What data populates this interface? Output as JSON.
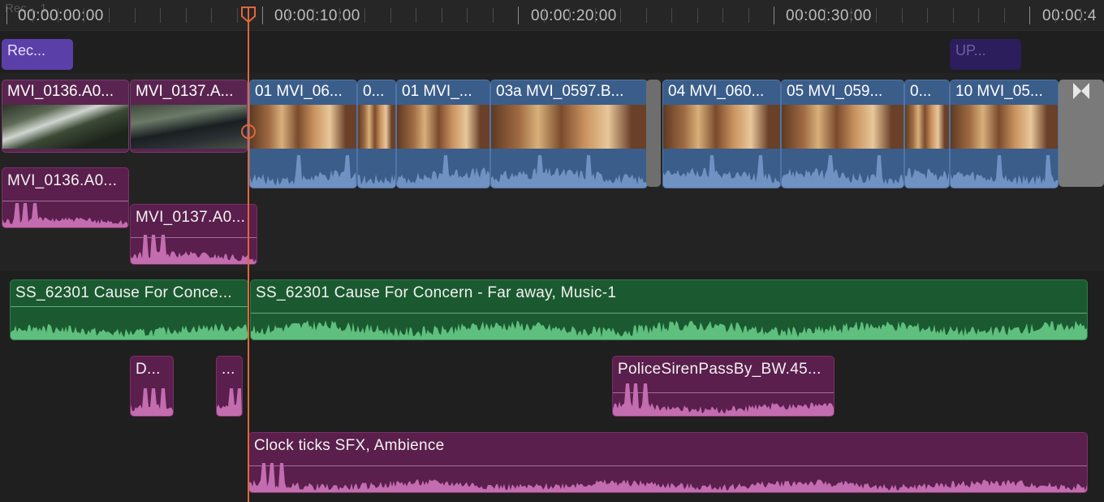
{
  "ruler": {
    "timecodes": [
      "00:00:00:00",
      "00:00:10:00",
      "00:00:20:00",
      "00:00:30:00",
      "00:00:4"
    ],
    "faint_label": "Rec... 1"
  },
  "markers": {
    "rec_label": "Rec...",
    "up_label": "UP..."
  },
  "video_clips": [
    "MVI_0136.A0...",
    "MVI_0137.A...",
    "01 MVI_06...",
    "0...",
    "01 MVI_...",
    "03a MVI_0597.B...",
    "04 MVI_060...",
    "05 MVI_059...",
    "0...",
    "10 MVI_05..."
  ],
  "connected_audio": {
    "clip_0136": "MVI_0136.A0...",
    "clip_0137": "MVI_0137.A0..."
  },
  "music": {
    "clip_a": "SS_62301 Cause For Conce...",
    "clip_b": "SS_62301 Cause For Concern - Far away, Music-1"
  },
  "sfx": {
    "d_clip": "D...",
    "small_clip": "...",
    "siren": "PoliceSirenPassBy_BW.45...",
    "clock": "Clock ticks SFX, Ambience"
  },
  "colors": {
    "video_primary": "#3b5d8a",
    "video_connected": "#5a2450",
    "music": "#1b5a30",
    "sfx": "#5a1f4c",
    "playhead": "#e0683a",
    "marker_rec": "#5b3fa8",
    "marker_up": "#2c1d5c"
  }
}
